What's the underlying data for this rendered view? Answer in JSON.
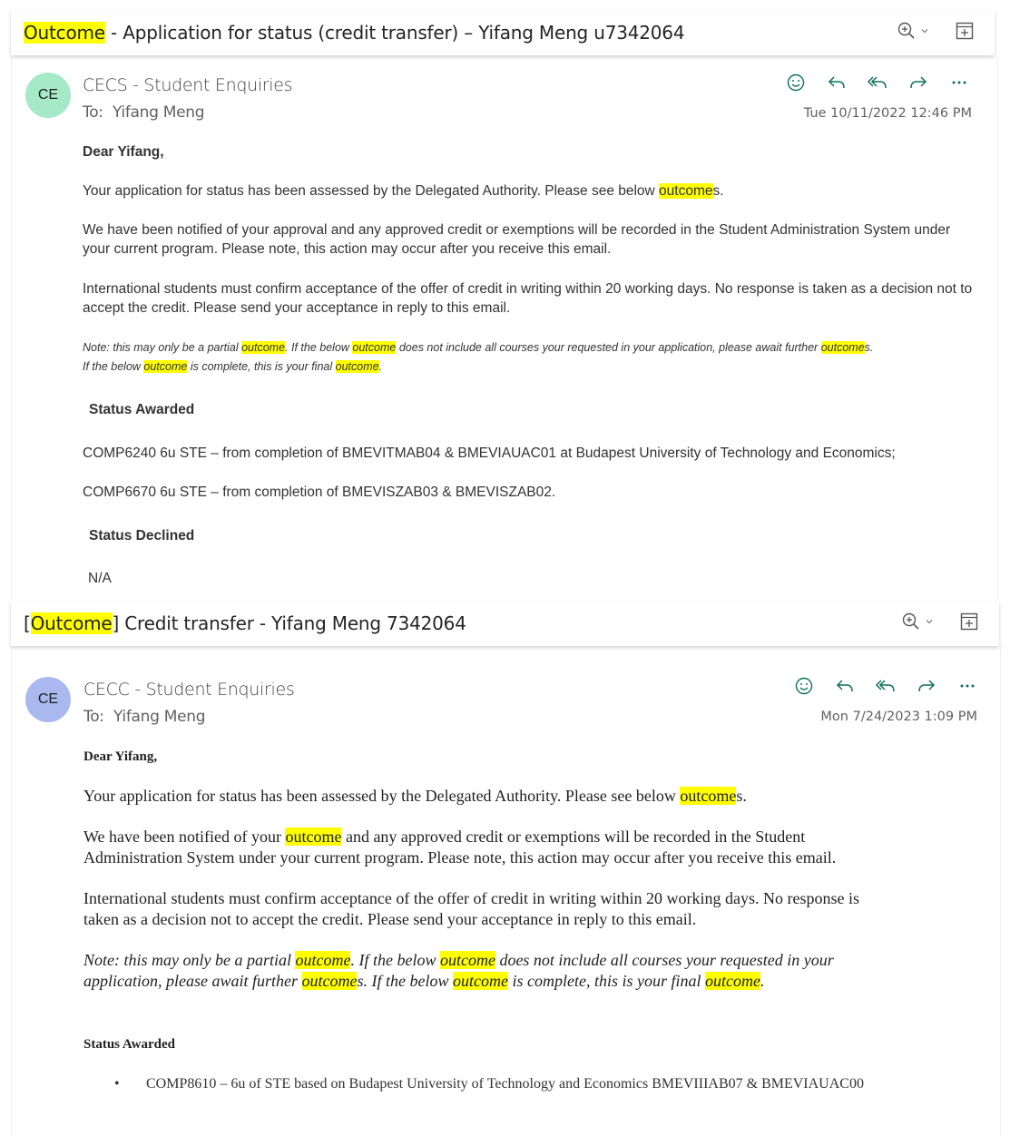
{
  "thread1": {
    "subject_highlight": "Outcome",
    "subject_rest": " - Application for status (credit transfer) – Yifang Meng u7342064",
    "avatar_initials": "CE",
    "avatar_color": "#a6e9c8",
    "sender": "CECS - Student Enquiries",
    "to_label": "To:",
    "to_name": "Yifang Meng",
    "date": "Tue 10/11/2022 12:46 PM",
    "greeting": "Dear Yifang,",
    "p1_a": "Your application for status has been assessed by the Delegated Authority. Please see below ",
    "p1_hl": "outcome",
    "p1_b": "s.",
    "p2": "We have been notified of your approval and any approved credit or exemptions will be recorded in the Student Administration System under your current program. Please note, this action may occur after you receive this email.",
    "p3": "International students must confirm acceptance of the offer of credit in writing within 20 working days. No response is taken as a decision not to accept the credit. Please send your acceptance in reply to this email.",
    "note": {
      "a": "Note: this may only be a partial ",
      "hl1": "outcome",
      "b": ". If the below ",
      "hl2": "outcome",
      "c": " does not include all courses your requested in your application, please await further ",
      "hl3": "outcome",
      "d": "s.",
      "e": "If the below ",
      "hl4": "outcome",
      "f": " is complete, this is your final ",
      "hl5": "outcome",
      "g": "."
    },
    "awarded_heading": "Status Awarded",
    "awarded_1": "COMP6240 6u STE – from completion of BMEVITMAB04 & BMEVIAUAC01 at Budapest University of Technology and Economics;",
    "awarded_2": "COMP6670 6u STE – from completion of BMEVISZAB03 & BMEVISZAB02.",
    "declined_heading": "Status Declined",
    "declined_value": "N/A"
  },
  "thread2": {
    "subject_open": "[",
    "subject_highlight": "Outcome",
    "subject_rest": "] Credit transfer - Yifang Meng 7342064",
    "avatar_initials": "CE",
    "avatar_color": "#a9b9ef",
    "sender": "CECC - Student Enquiries",
    "to_label": "To:",
    "to_name": "Yifang Meng",
    "date": "Mon 7/24/2023 1:09 PM",
    "greeting": "Dear Yifang,",
    "p1_a": "Your application for status has been assessed by the Delegated Authority. Please see below ",
    "p1_hl": "outcome",
    "p1_b": "s.",
    "p2_a": "We have been notified of your ",
    "p2_hl": "outcome",
    "p2_b": " and any approved credit or exemptions will be recorded in the Student",
    "p2_c": "Administration System under your current program. Please note, this action may occur after you receive this email.",
    "p3_a": "International students must confirm acceptance of the offer of credit in writing within 20 working days. No response is",
    "p3_b": "taken as a decision not to accept the credit. Please send your acceptance in reply to this email.",
    "note": {
      "a": "Note: this may only be a partial ",
      "hl1": "outcome",
      "b": ". If the below ",
      "hl2": "outcome",
      "c": " does not include all courses your requested in your",
      "d": "application, please await further ",
      "hl3": "outcome",
      "e": "s. If the below ",
      "hl4": "outcome",
      "f": " is complete, this is your final ",
      "hl5": "outcome",
      "g": "."
    },
    "awarded_heading": "Status Awarded",
    "bullet": "•",
    "awarded_1": "COMP8610 – 6u of STE based on Budapest University of Technology and Economics BMEVIIIAB07 & BMEVIAUAC00"
  },
  "colors": {
    "highlight": "#ffff00",
    "accent": "#0f6f5f"
  },
  "icons": [
    "zoom-in-icon",
    "chevron-down-icon",
    "open-in-window-icon",
    "emoji-icon",
    "reply-icon",
    "reply-all-icon",
    "forward-icon",
    "more-icon"
  ]
}
